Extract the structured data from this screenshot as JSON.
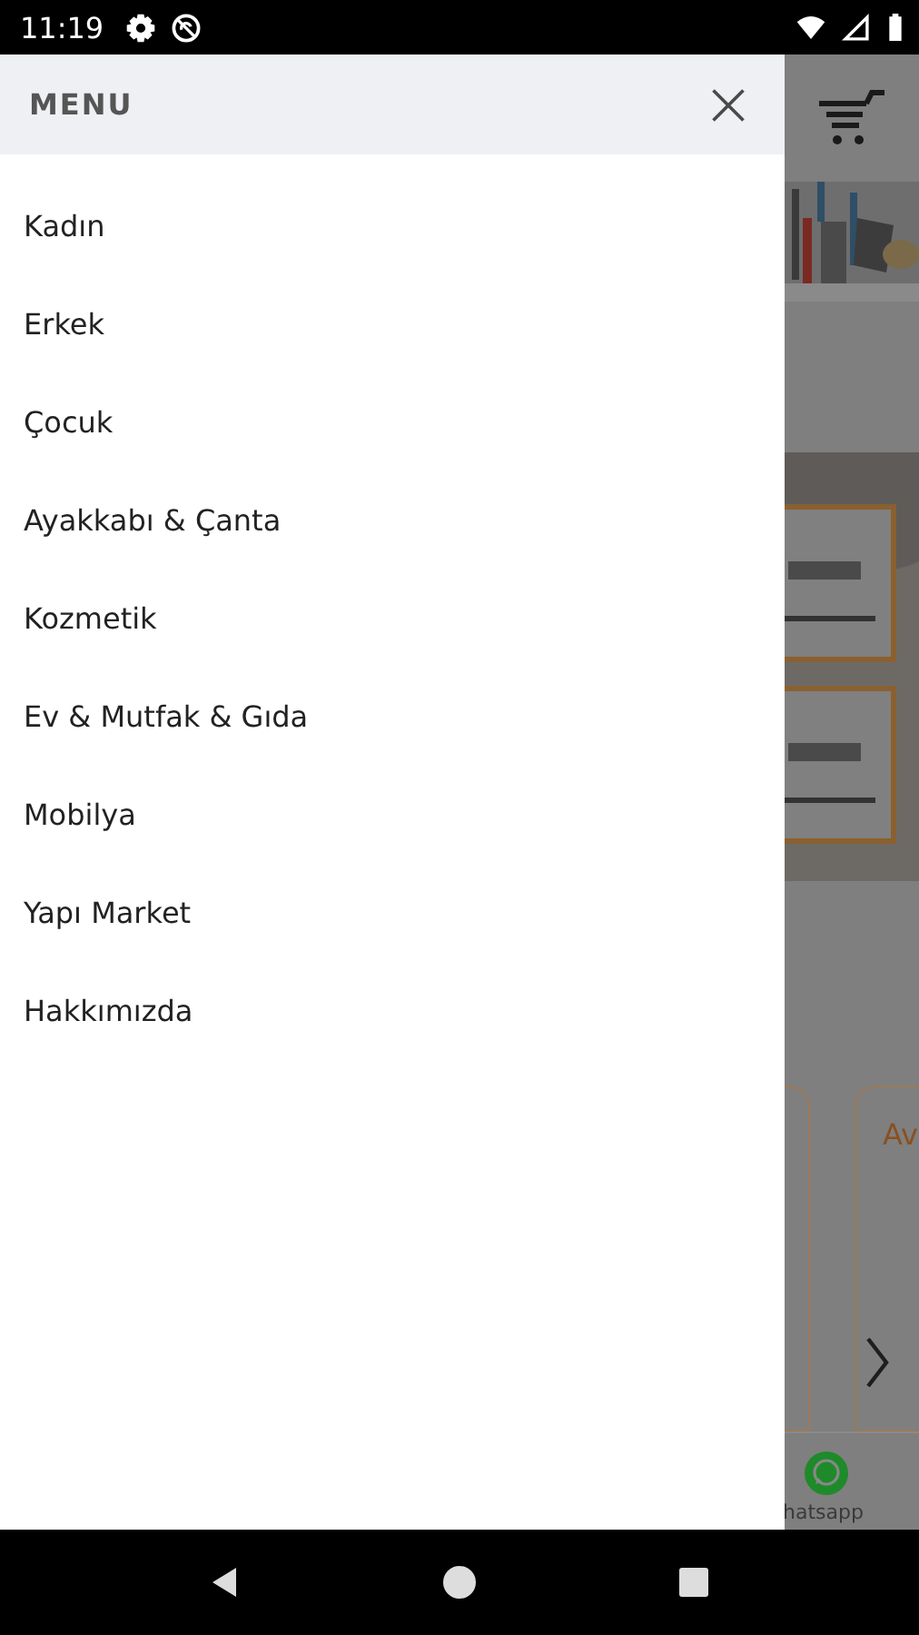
{
  "status_bar": {
    "time": "11:19"
  },
  "menu": {
    "title": "MENU",
    "items": [
      {
        "label": "Kadın"
      },
      {
        "label": "Erkek"
      },
      {
        "label": "Çocuk"
      },
      {
        "label": "Ayakkabı & Çanta"
      },
      {
        "label": "Kozmetik"
      },
      {
        "label": "Ev & Mutfak & Gıda"
      },
      {
        "label": "Mobilya"
      },
      {
        "label": "Yapı Market"
      },
      {
        "label": "Hakkımızda"
      }
    ]
  },
  "background_page": {
    "card_title": "Av",
    "bottom_bar": {
      "label": "hatsapp"
    }
  }
}
